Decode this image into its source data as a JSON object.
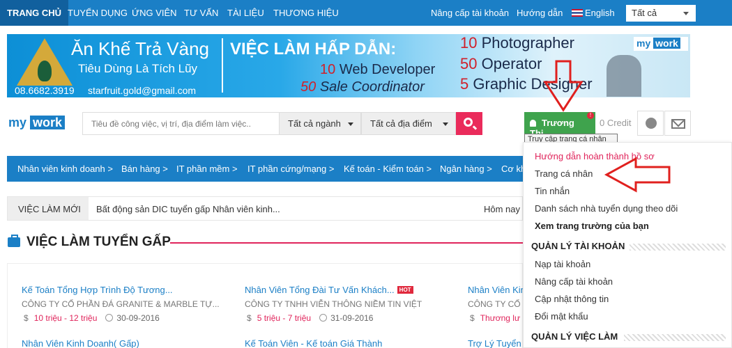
{
  "topnav": {
    "items": [
      "TRANG CHỦ",
      "TUYỂN DỤNG",
      "ỨNG VIÊN",
      "TƯ VẤN",
      "TÀI LIỆU",
      "THƯƠNG HIỆU"
    ],
    "upgrade": "Nâng cấp tài khoản",
    "guide": "Hướng dẫn",
    "language": "English",
    "lang_select": "Tất cả"
  },
  "banner": {
    "brand_title": "Ăn Khế Trả Vàng",
    "brand_sub": "Tiêu Dùng Là Tích Lũy",
    "phone": "08.6682.3919",
    "email": "starfruit.gold@gmail.com",
    "headline": "VIỆC LÀM HẤP DẪN:",
    "lines": [
      {
        "num": "10",
        "text": "Web Developer"
      },
      {
        "num": "50",
        "text": "Sale Coordinator"
      },
      {
        "num": "10",
        "text": "Photographer"
      },
      {
        "num": "50",
        "text": "Operator"
      },
      {
        "num": "5",
        "text": "Graphic Designer"
      }
    ],
    "mini_logo": {
      "a": "my",
      "b": "work"
    }
  },
  "header": {
    "logo": {
      "a": "my",
      "b": "work"
    },
    "search_placeholder": "Tiêu đề công việc, vị trí, địa điểm làm việc..",
    "industry": "Tất cả ngành",
    "location": "Tất cả địa điểm",
    "user_name": "Trương Thị...",
    "notif_count": "!",
    "credit": "0 Credit",
    "tooltip": "Truy cập trang cá nhân"
  },
  "categories": [
    "Nhân viên kinh doanh >",
    "Bán hàng >",
    "IT phần mềm >",
    "IT phần cứng/mạng >",
    "Kế toán - Kiểm toán >",
    "Ngân hàng >",
    "Cơ khí"
  ],
  "ticker": {
    "label": "VIỆC LÀM MỚI",
    "text": "Bất động sản DIC tuyển gấp Nhân viên kinh...",
    "date": "Hôm nay c"
  },
  "urgent": {
    "title": "VIỆC LÀM TUYỂN GẤP",
    "jobs": [
      {
        "title": "Kế Toán Tổng Hợp Trình Độ Tương...",
        "company": "CÔNG TY CỔ PHẦN ĐÁ GRANITE & MARBLE TỰ...",
        "salary": "10 triệu - 12 triệu",
        "date": "30-09-2016",
        "hot": ""
      },
      {
        "title": "Nhân Viên Tổng Đài Tư Vấn Khách...",
        "company": "CÔNG TY TNHH VIỄN THÔNG NIỀM TIN VIỆT",
        "salary": "5 triệu - 7 triệu",
        "date": "31-09-2016",
        "hot": "HOT"
      },
      {
        "title": "Nhân Viên Kin",
        "company": "CÔNG TY CỔ",
        "salary": "Thương lư",
        "date": "",
        "hot": ""
      }
    ],
    "row2": [
      "Nhân Viên Kinh Doanh( Gấp)",
      "Kế Toán Viên - Kế toán Giá Thành",
      "Trợ Lý Tuyển D"
    ]
  },
  "menu": {
    "items_top": [
      "Hướng dẫn hoàn thành hồ sơ",
      "Trang cá nhân",
      "Tin nhắn",
      "Danh sách nhà tuyển dụng theo dõi",
      "Xem trang trường của bạn"
    ],
    "section1": "QUẢN LÝ TÀI KHOẢN",
    "items_account": [
      "Nạp tài khoản",
      "Nâng cấp tài khoản",
      "Cập nhật thông tin",
      "Đổi mật khẩu"
    ],
    "section2": "QUẢN LÝ VIỆC LÀM"
  },
  "colors": {
    "primary": "#1b7fc6",
    "accent": "#e0245b",
    "green": "#3fa34d",
    "arrow": "#e0201e"
  }
}
